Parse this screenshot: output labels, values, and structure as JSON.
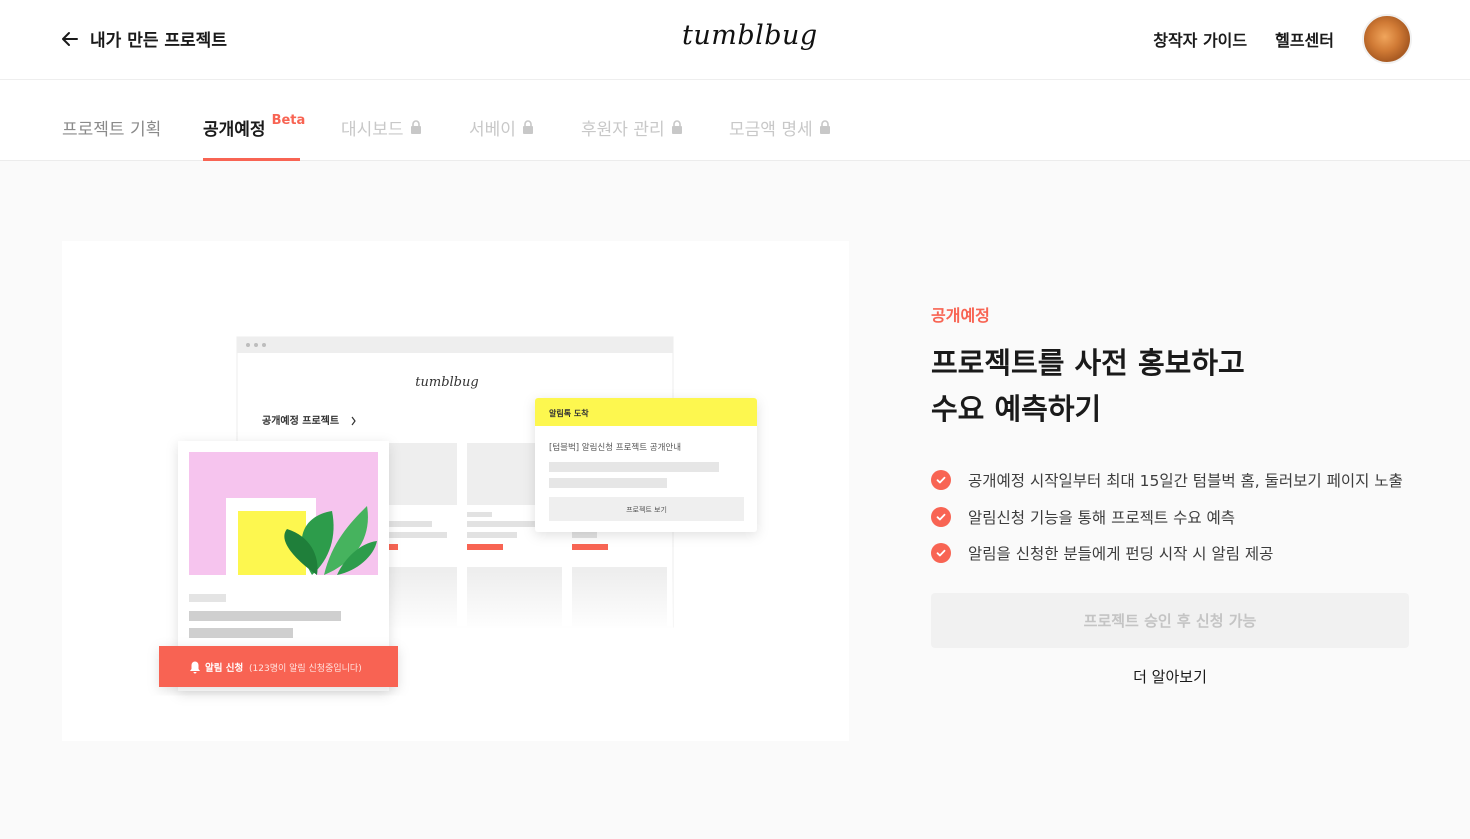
{
  "header": {
    "back_label": "내가 만든 프로젝트",
    "logo": "tumblbug",
    "links": [
      "창작자 가이드",
      "헬프센터"
    ]
  },
  "tabs": [
    {
      "label": "프로젝트 기획",
      "state": "normal"
    },
    {
      "label": "공개예정",
      "badge": "Beta",
      "state": "active"
    },
    {
      "label": "대시보드",
      "state": "locked"
    },
    {
      "label": "서베이",
      "state": "locked"
    },
    {
      "label": "후원자 관리",
      "state": "locked"
    },
    {
      "label": "모금액 명세",
      "state": "locked"
    }
  ],
  "illustration": {
    "logo": "tumblbug",
    "section_title": "공개예정 프로젝트",
    "notify_header": "알림톡 도착",
    "notify_message": "[텀블벅] 알림신청 프로젝트 공개안내",
    "notify_button": "프로젝트 보기",
    "alarm_button_label": "알림 신청",
    "alarm_button_count": "(123명이 알림 신청중입니다)"
  },
  "panel": {
    "eyebrow": "공개예정",
    "headline_line1": "프로젝트를 사전 홍보하고",
    "headline_line2": "수요 예측하기",
    "features": [
      "공개예정 시작일부터 최대 15일간 텀블벅 홈, 둘러보기 페이지 노출",
      "알림신청 기능을 통해 프로젝트 수요 예측",
      "알림을 신청한 분들에게 펀딩 시작 시 알림 제공"
    ],
    "cta_label": "프로젝트 승인 후 신청 가능",
    "learn_more": "더 알아보기"
  },
  "colors": {
    "accent": "#f86453",
    "notify_yellow": "#fdf74f",
    "pink": "#f6c4ee",
    "disabled_text": "#c4c4c4"
  },
  "icons": [
    "arrow-left-icon",
    "lock-icon",
    "check-icon",
    "bell-icon",
    "chevron-right-icon"
  ]
}
